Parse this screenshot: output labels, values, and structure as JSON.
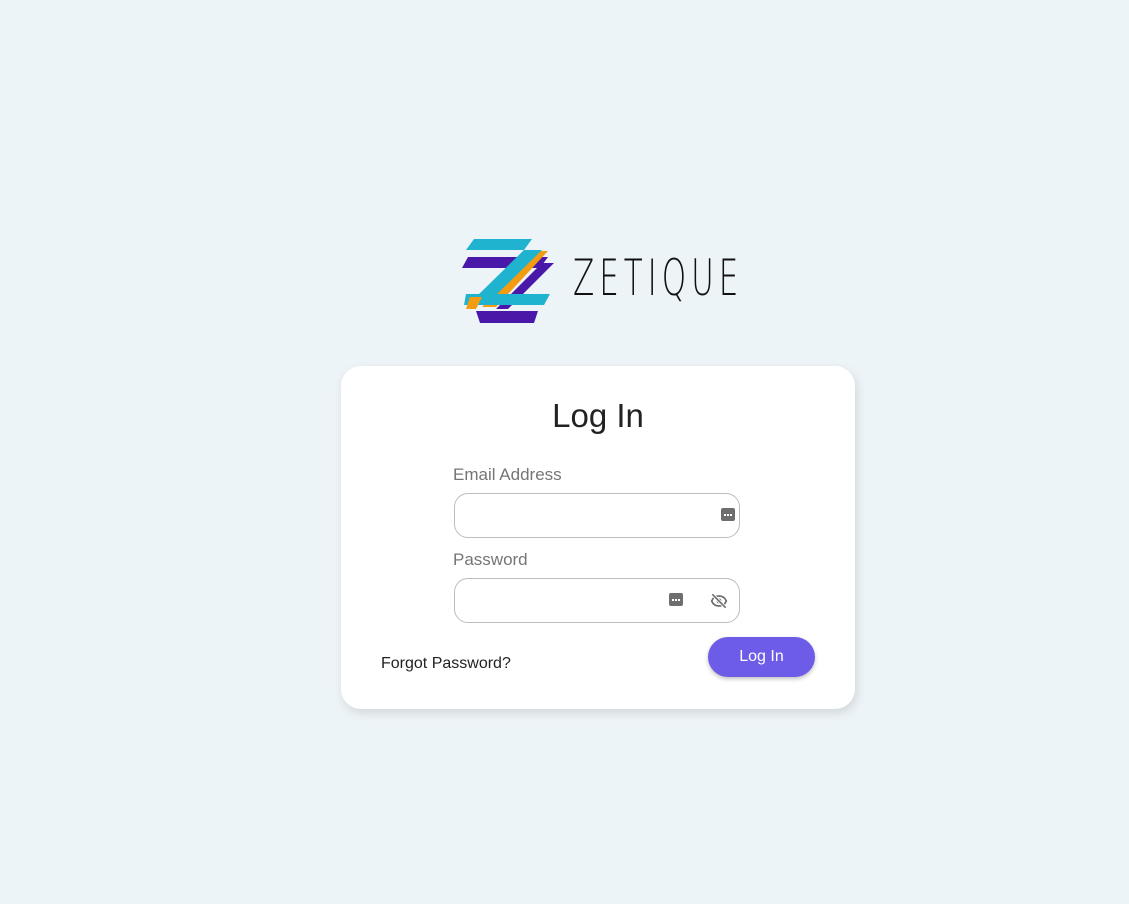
{
  "brand": {
    "name": "ZETIQUE",
    "colors": {
      "cyan": "#1fb3cf",
      "purple": "#4a18a8",
      "orange": "#f39c12"
    }
  },
  "login": {
    "title": "Log In",
    "email_label": "Email Address",
    "email_value": "",
    "password_label": "Password",
    "password_value": "",
    "forgot_label": "Forgot Password?",
    "submit_label": "Log In"
  },
  "icons": {
    "email_field_icon": "password-manager-keys-icon",
    "password_field_icon": "password-manager-keys-icon",
    "password_toggle": "eye-off-icon"
  },
  "colors": {
    "background": "#edf4f7",
    "card": "#ffffff",
    "accent": "#6c5ce7"
  }
}
